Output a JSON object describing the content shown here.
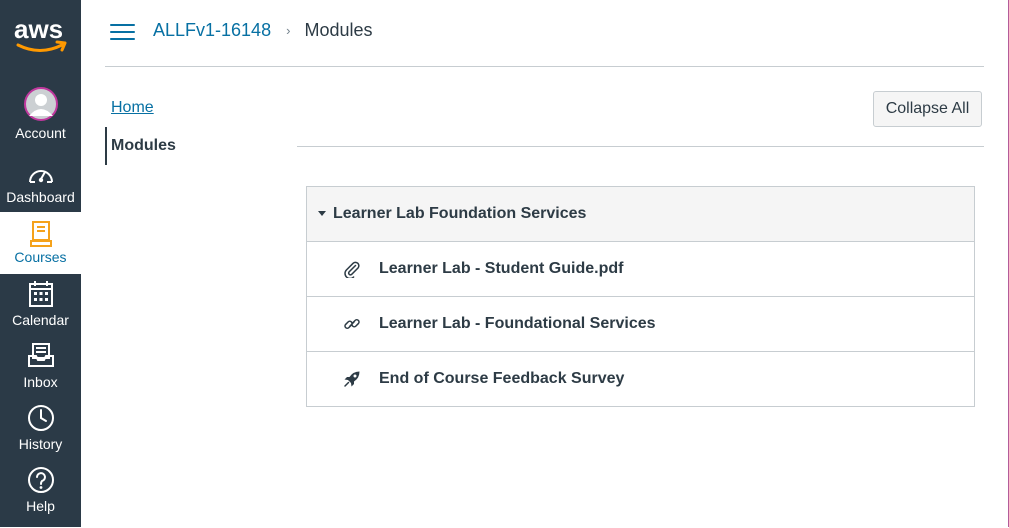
{
  "brand": {
    "logo_text": "aws"
  },
  "global_nav": {
    "items": [
      {
        "label": "Account",
        "icon": "avatar-icon"
      },
      {
        "label": "Dashboard",
        "icon": "dashboard-icon"
      },
      {
        "label": "Courses",
        "icon": "courses-icon",
        "active": true
      },
      {
        "label": "Calendar",
        "icon": "calendar-icon"
      },
      {
        "label": "Inbox",
        "icon": "inbox-icon"
      },
      {
        "label": "History",
        "icon": "history-icon"
      },
      {
        "label": "Help",
        "icon": "help-icon"
      }
    ],
    "active_color": "#0770a3",
    "background_color": "#2b3a47"
  },
  "breadcrumb": {
    "course": "ALLFv1-16148",
    "separator": "›",
    "current": "Modules"
  },
  "course_nav": {
    "items": [
      "Home",
      "Modules"
    ],
    "active": "Modules"
  },
  "toolbar": {
    "collapse_label": "Collapse All"
  },
  "module": {
    "title": "Learner Lab Foundation Services",
    "items": [
      {
        "title": "Learner Lab - Student Guide.pdf",
        "icon": "paperclip-icon"
      },
      {
        "title": "Learner Lab - Foundational Services",
        "icon": "link-icon"
      },
      {
        "title": "End of Course Feedback Survey",
        "icon": "rocket-icon"
      }
    ]
  }
}
